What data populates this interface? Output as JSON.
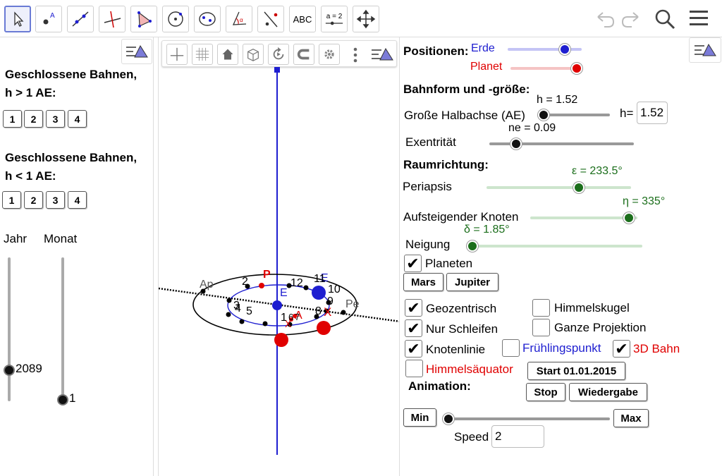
{
  "toolbar": {
    "text_tool": "ABC",
    "slider_tool": "a = 2"
  },
  "left": {
    "section1_line1": "Geschlossene Bahnen,",
    "section1_line2": "h > 1 AE:",
    "section1_buttons": [
      "1",
      "2",
      "3",
      "4"
    ],
    "section2_line1": "Geschlossene Bahnen,",
    "section2_line2": "h < 1 AE:",
    "section2_buttons": [
      "1",
      "2",
      "3",
      "4"
    ],
    "jahr_label": "Jahr",
    "monat_label": "Monat",
    "jahr_value": "2089",
    "monat_value": "1"
  },
  "graphics": {
    "labels": {
      "ap": "Ap",
      "pe": "Pe",
      "p": "P",
      "e": "E",
      "e2": "E",
      "x": "X",
      "x2": "X",
      "a": "A",
      "n": [
        "1",
        "2",
        "3",
        "4",
        "5",
        "6",
        "7",
        "8",
        "9",
        "10",
        "11",
        "12"
      ],
      "big_1": "1",
      "big_5": "5"
    }
  },
  "right": {
    "positionen": "Positionen:",
    "erde": "Erde",
    "planet": "Planet",
    "bahnform": "Bahnform und -größe:",
    "h_display": "h = 1.52",
    "halbachse": "Große Halbachse (AE)",
    "h_input_label": "h=",
    "h_input_value": "1.52",
    "ne_display": "ne = 0.09",
    "exzentritaet": "Exentrität",
    "raumrichtung": "Raumrichtung:",
    "epsilon_display": "ε = 233.5°",
    "periapsis": "Periapsis",
    "eta_display": "η = 335°",
    "knoten": "Aufsteigender Knoten",
    "delta_display": "δ = 1.85°",
    "neigung": "Neigung",
    "planeten_cb": "Planeten",
    "mars": "Mars",
    "jupiter": "Jupiter",
    "geozentrisch": "Geozentrisch",
    "himmelskugel": "Himmelskugel",
    "nur_schleifen": "Nur Schleifen",
    "ganze_projektion": "Ganze Projektion",
    "knotenlinie": "Knotenlinie",
    "fruehlingspunkt": "Frühlingspunkt",
    "bahn3d": "3D Bahn",
    "himmelsaequator": "Himmelsäquator",
    "start": "Start 01.01.2015",
    "animation": "Animation:",
    "stop": "Stop",
    "wiedergabe": "Wiedergabe",
    "min": "Min",
    "max": "Max",
    "speed_label": "Speed",
    "speed_value": "2"
  },
  "colors": {
    "earth": "#1e1ed0",
    "planet": "#e00000",
    "green": "#1b6e1b",
    "accent": "#6a7bd5"
  }
}
